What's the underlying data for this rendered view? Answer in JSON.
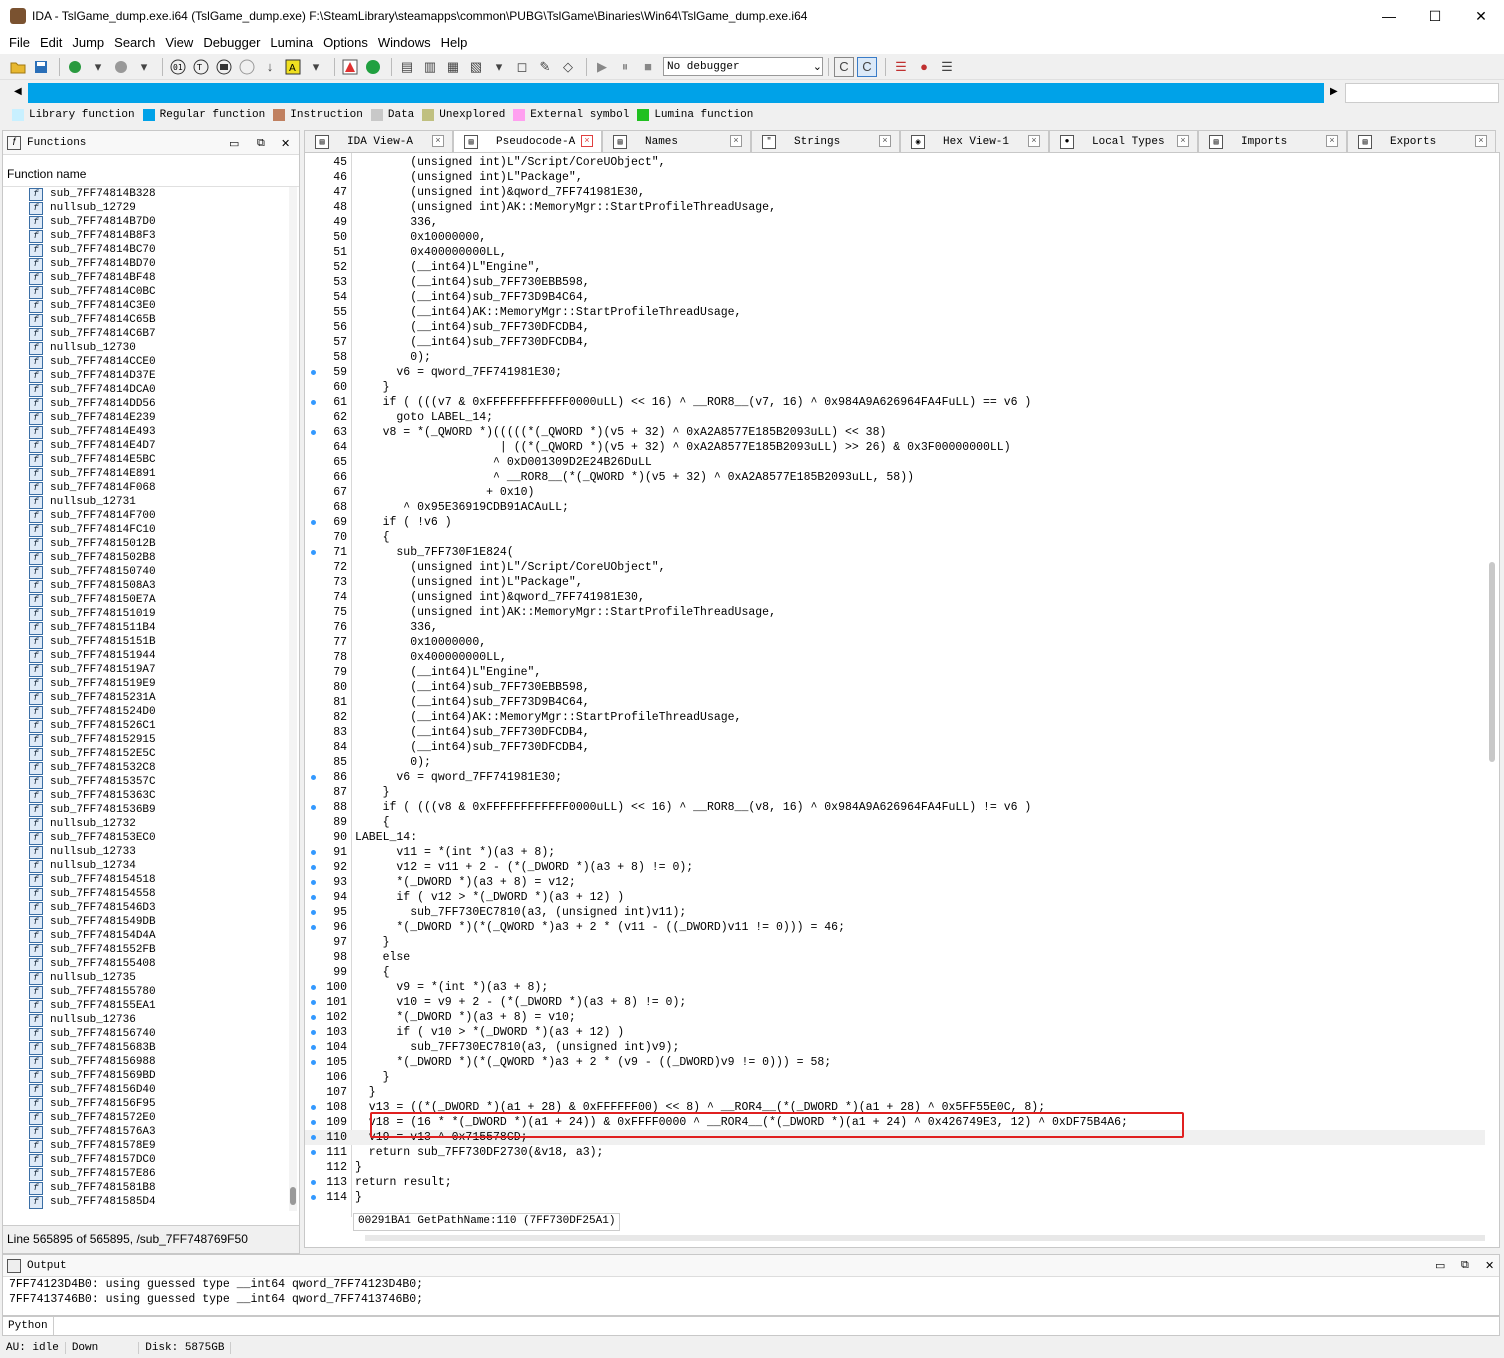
{
  "window": {
    "title": "IDA - TslGame_dump.exe.i64 (TslGame_dump.exe) F:\\SteamLibrary\\steamapps\\common\\PUBG\\TslGame\\Binaries\\Win64\\TslGame_dump.exe.i64",
    "minimize_glyph": "—",
    "maximize_glyph": "☐",
    "close_glyph": "✕"
  },
  "menu": [
    "File",
    "Edit",
    "Jump",
    "Search",
    "View",
    "Debugger",
    "Lumina",
    "Options",
    "Windows",
    "Help"
  ],
  "toolbar": {
    "debugger_select": "No debugger"
  },
  "legend": [
    {
      "label": "Library function",
      "color": "#c8f0ff"
    },
    {
      "label": "Regular function",
      "color": "#00a2e8"
    },
    {
      "label": "Instruction",
      "color": "#c08060"
    },
    {
      "label": "Data",
      "color": "#c8c8c8"
    },
    {
      "label": "Unexplored",
      "color": "#c0c080"
    },
    {
      "label": "External symbol",
      "color": "#ffa0f0"
    },
    {
      "label": "Lumina function",
      "color": "#20c020"
    }
  ],
  "functions_panel": {
    "title": "Functions",
    "column_header": "Function name",
    "items": [
      "sub_7FF74814B328",
      "nullsub_12729",
      "sub_7FF74814B7D0",
      "sub_7FF74814B8F3",
      "sub_7FF74814BC70",
      "sub_7FF74814BD70",
      "sub_7FF74814BF48",
      "sub_7FF74814C0BC",
      "sub_7FF74814C3E0",
      "sub_7FF74814C65B",
      "sub_7FF74814C6B7",
      "nullsub_12730",
      "sub_7FF74814CCE0",
      "sub_7FF74814D37E",
      "sub_7FF74814DCA0",
      "sub_7FF74814DD56",
      "sub_7FF74814E239",
      "sub_7FF74814E493",
      "sub_7FF74814E4D7",
      "sub_7FF74814E5BC",
      "sub_7FF74814E891",
      "sub_7FF74814F068",
      "nullsub_12731",
      "sub_7FF74814F700",
      "sub_7FF74814FC10",
      "sub_7FF74815012B",
      "sub_7FF7481502B8",
      "sub_7FF748150740",
      "sub_7FF7481508A3",
      "sub_7FF748150E7A",
      "sub_7FF748151019",
      "sub_7FF7481511B4",
      "sub_7FF74815151B",
      "sub_7FF748151944",
      "sub_7FF7481519A7",
      "sub_7FF7481519E9",
      "sub_7FF74815231A",
      "sub_7FF7481524D0",
      "sub_7FF7481526C1",
      "sub_7FF748152915",
      "sub_7FF748152E5C",
      "sub_7FF7481532C8",
      "sub_7FF74815357C",
      "sub_7FF74815363C",
      "sub_7FF7481536B9",
      "nullsub_12732",
      "sub_7FF748153EC0",
      "nullsub_12733",
      "nullsub_12734",
      "sub_7FF748154518",
      "sub_7FF748154558",
      "sub_7FF7481546D3",
      "sub_7FF7481549DB",
      "sub_7FF748154D4A",
      "sub_7FF7481552FB",
      "sub_7FF748155408",
      "nullsub_12735",
      "sub_7FF748155780",
      "sub_7FF748155EA1",
      "nullsub_12736",
      "sub_7FF748156740",
      "sub_7FF74815683B",
      "sub_7FF748156988",
      "sub_7FF7481569BD",
      "sub_7FF748156D40",
      "sub_7FF748156F95",
      "sub_7FF7481572E0",
      "sub_7FF7481576A3",
      "sub_7FF7481578E9",
      "sub_7FF748157DC0",
      "sub_7FF748157E86",
      "sub_7FF7481581B8",
      "sub_7FF7481585D4"
    ],
    "status": "Line 565895 of 565895, /sub_7FF748769F50"
  },
  "tabs": [
    "IDA View-A",
    "Pseudocode-A",
    "Names",
    "Strings",
    "Hex View-1",
    "Local Types",
    "Imports",
    "Exports"
  ],
  "code": {
    "lines": [
      {
        "n": "45",
        "dot": false,
        "t": "        (unsigned int)L\"/Script/CoreUObject\","
      },
      {
        "n": "46",
        "dot": false,
        "t": "        (unsigned int)L\"Package\","
      },
      {
        "n": "47",
        "dot": false,
        "t": "        (unsigned int)&qword_7FF741981E30,"
      },
      {
        "n": "48",
        "dot": false,
        "t": "        (unsigned int)AK::MemoryMgr::StartProfileThreadUsage,"
      },
      {
        "n": "49",
        "dot": false,
        "t": "        336,"
      },
      {
        "n": "50",
        "dot": false,
        "t": "        0x10000000,"
      },
      {
        "n": "51",
        "dot": false,
        "t": "        0x400000000LL,"
      },
      {
        "n": "52",
        "dot": false,
        "t": "        (__int64)L\"Engine\","
      },
      {
        "n": "53",
        "dot": false,
        "t": "        (__int64)sub_7FF730EBB598,"
      },
      {
        "n": "54",
        "dot": false,
        "t": "        (__int64)sub_7FF73D9B4C64,"
      },
      {
        "n": "55",
        "dot": false,
        "t": "        (__int64)AK::MemoryMgr::StartProfileThreadUsage,"
      },
      {
        "n": "56",
        "dot": false,
        "t": "        (__int64)sub_7FF730DFCDB4,"
      },
      {
        "n": "57",
        "dot": false,
        "t": "        (__int64)sub_7FF730DFCDB4,"
      },
      {
        "n": "58",
        "dot": false,
        "t": "        0);"
      },
      {
        "n": "59",
        "dot": true,
        "t": "      v6 = qword_7FF741981E30;"
      },
      {
        "n": "60",
        "dot": false,
        "t": "    }"
      },
      {
        "n": "61",
        "dot": true,
        "t": "    if ( (((v7 & 0xFFFFFFFFFFFF0000uLL) << 16) ^ __ROR8__(v7, 16) ^ 0x984A9A626964FA4FuLL) == v6 )"
      },
      {
        "n": "62",
        "dot": false,
        "t": "      goto LABEL_14;"
      },
      {
        "n": "63",
        "dot": true,
        "t": "    v8 = *(_QWORD *)(((((*(_QWORD *)(v5 + 32) ^ 0xA2A8577E185B2093uLL) << 38)"
      },
      {
        "n": "64",
        "dot": false,
        "t": "                     | ((*(_QWORD *)(v5 + 32) ^ 0xA2A8577E185B2093uLL) >> 26) & 0x3F00000000LL)"
      },
      {
        "n": "65",
        "dot": false,
        "t": "                    ^ 0xD001309D2E24B26DuLL"
      },
      {
        "n": "66",
        "dot": false,
        "t": "                    ^ __ROR8__(*(_QWORD *)(v5 + 32) ^ 0xA2A8577E185B2093uLL, 58))"
      },
      {
        "n": "67",
        "dot": false,
        "t": "                   + 0x10)"
      },
      {
        "n": "68",
        "dot": false,
        "t": "       ^ 0x95E36919CDB91ACAuLL;"
      },
      {
        "n": "69",
        "dot": true,
        "t": "    if ( !v6 )"
      },
      {
        "n": "70",
        "dot": false,
        "t": "    {"
      },
      {
        "n": "71",
        "dot": true,
        "t": "      sub_7FF730F1E824("
      },
      {
        "n": "72",
        "dot": false,
        "t": "        (unsigned int)L\"/Script/CoreUObject\","
      },
      {
        "n": "73",
        "dot": false,
        "t": "        (unsigned int)L\"Package\","
      },
      {
        "n": "74",
        "dot": false,
        "t": "        (unsigned int)&qword_7FF741981E30,"
      },
      {
        "n": "75",
        "dot": false,
        "t": "        (unsigned int)AK::MemoryMgr::StartProfileThreadUsage,"
      },
      {
        "n": "76",
        "dot": false,
        "t": "        336,"
      },
      {
        "n": "77",
        "dot": false,
        "t": "        0x10000000,"
      },
      {
        "n": "78",
        "dot": false,
        "t": "        0x400000000LL,"
      },
      {
        "n": "79",
        "dot": false,
        "t": "        (__int64)L\"Engine\","
      },
      {
        "n": "80",
        "dot": false,
        "t": "        (__int64)sub_7FF730EBB598,"
      },
      {
        "n": "81",
        "dot": false,
        "t": "        (__int64)sub_7FF73D9B4C64,"
      },
      {
        "n": "82",
        "dot": false,
        "t": "        (__int64)AK::MemoryMgr::StartProfileThreadUsage,"
      },
      {
        "n": "83",
        "dot": false,
        "t": "        (__int64)sub_7FF730DFCDB4,"
      },
      {
        "n": "84",
        "dot": false,
        "t": "        (__int64)sub_7FF730DFCDB4,"
      },
      {
        "n": "85",
        "dot": false,
        "t": "        0);"
      },
      {
        "n": "86",
        "dot": true,
        "t": "      v6 = qword_7FF741981E30;"
      },
      {
        "n": "87",
        "dot": false,
        "t": "    }"
      },
      {
        "n": "88",
        "dot": true,
        "t": "    if ( (((v8 & 0xFFFFFFFFFFFF0000uLL) << 16) ^ __ROR8__(v8, 16) ^ 0x984A9A626964FA4FuLL) != v6 )"
      },
      {
        "n": "89",
        "dot": false,
        "t": "    {"
      },
      {
        "n": "90",
        "dot": false,
        "t": "LABEL_14:"
      },
      {
        "n": "91",
        "dot": true,
        "t": "      v11 = *(int *)(a3 + 8);"
      },
      {
        "n": "92",
        "dot": true,
        "t": "      v12 = v11 + 2 - (*(_DWORD *)(a3 + 8) != 0);"
      },
      {
        "n": "93",
        "dot": true,
        "t": "      *(_DWORD *)(a3 + 8) = v12;"
      },
      {
        "n": "94",
        "dot": true,
        "t": "      if ( v12 > *(_DWORD *)(a3 + 12) )"
      },
      {
        "n": "95",
        "dot": true,
        "t": "        sub_7FF730EC7810(a3, (unsigned int)v11);"
      },
      {
        "n": "96",
        "dot": true,
        "t": "      *(_DWORD *)(*(_QWORD *)a3 + 2 * (v11 - ((_DWORD)v11 != 0))) = 46;"
      },
      {
        "n": "97",
        "dot": false,
        "t": "    }"
      },
      {
        "n": "98",
        "dot": false,
        "t": "    else"
      },
      {
        "n": "99",
        "dot": false,
        "t": "    {"
      },
      {
        "n": "100",
        "dot": true,
        "t": "      v9 = *(int *)(a3 + 8);"
      },
      {
        "n": "101",
        "dot": true,
        "t": "      v10 = v9 + 2 - (*(_DWORD *)(a3 + 8) != 0);"
      },
      {
        "n": "102",
        "dot": true,
        "t": "      *(_DWORD *)(a3 + 8) = v10;"
      },
      {
        "n": "103",
        "dot": true,
        "t": "      if ( v10 > *(_DWORD *)(a3 + 12) )"
      },
      {
        "n": "104",
        "dot": true,
        "t": "        sub_7FF730EC7810(a3, (unsigned int)v9);"
      },
      {
        "n": "105",
        "dot": true,
        "t": "      *(_DWORD *)(*(_QWORD *)a3 + 2 * (v9 - ((_DWORD)v9 != 0))) = 58;"
      },
      {
        "n": "106",
        "dot": false,
        "t": "    }"
      },
      {
        "n": "107",
        "dot": false,
        "t": "  }"
      },
      {
        "n": "108",
        "dot": true,
        "t": "  v13 = ((*(_DWORD *)(a1 + 28) & 0xFFFFFF00) << 8) ^ __ROR4__(*(_DWORD *)(a1 + 28) ^ 0x5FF55E0C, 8);"
      },
      {
        "n": "109",
        "dot": true,
        "t": "  v18 = (16 * *(_DWORD *)(a1 + 24)) & 0xFFFF0000 ^ __ROR4__(*(_DWORD *)(a1 + 24) ^ 0x426749E3, 12) ^ 0xDF75B4A6;"
      },
      {
        "n": "110",
        "dot": true,
        "t": "  v19 = v13 ^ 0x715578CD;"
      },
      {
        "n": "111",
        "dot": true,
        "t": "  return sub_7FF730DF2730(&v18, a3);"
      },
      {
        "n": "112",
        "dot": false,
        "t": "}"
      },
      {
        "n": "113",
        "dot": true,
        "t": "return result;"
      },
      {
        "n": "114",
        "dot": true,
        "t": "}"
      }
    ],
    "cursor_line": "110",
    "status": "00291BA1 GetPathName:110 (7FF730DF25A1)"
  },
  "output": {
    "title": "Output",
    "lines": [
      "7FF74123D4B0: using guessed type __int64 qword_7FF74123D4B0;",
      "7FF7413746B0: using guessed type __int64 qword_7FF7413746B0;"
    ],
    "python_button": "Python"
  },
  "statusbar": {
    "au": "AU:  idle",
    "direction": "Down",
    "disk": "Disk: 5875GB"
  }
}
